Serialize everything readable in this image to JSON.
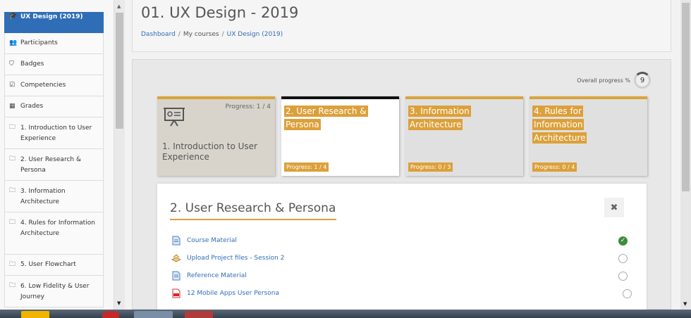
{
  "sidebar": {
    "items": [
      {
        "label": "UX Design (2019)",
        "icon": "graduation-cap-icon",
        "glyph": "🎓"
      },
      {
        "label": "Participants",
        "icon": "users-icon",
        "glyph": "👥"
      },
      {
        "label": "Badges",
        "icon": "shield-icon",
        "glyph": "⛉"
      },
      {
        "label": "Competencies",
        "icon": "checkbox-icon",
        "glyph": "☑"
      },
      {
        "label": "Grades",
        "icon": "table-icon",
        "glyph": "▦"
      },
      {
        "label": "1. Introduction to User Experience",
        "icon": "folder-icon",
        "glyph": "🗀"
      },
      {
        "label": "2. User Research & Persona",
        "icon": "folder-icon",
        "glyph": "🗀"
      },
      {
        "label": "3. Information Architecture",
        "icon": "folder-icon",
        "glyph": "🗀"
      },
      {
        "label": "4. Rules for Information Architecture",
        "icon": "folder-icon",
        "glyph": "🗀"
      },
      {
        "label": "5. User Flowchart",
        "icon": "folder-icon",
        "glyph": "🗀"
      },
      {
        "label": "6. Low Fidelity & User Journey",
        "icon": "folder-icon",
        "glyph": "🗀"
      }
    ]
  },
  "header": {
    "title": "01. UX Design - 2019",
    "breadcrumb": [
      "Dashboard",
      "My courses",
      "UX Design (2019)"
    ],
    "breadcrumb_sep": "/"
  },
  "overall": {
    "label": "Overall progress %",
    "value": "9"
  },
  "tiles": [
    {
      "title": "1. Introduction to User Experience",
      "progress": "Progress: 1 / 4"
    },
    {
      "title": "2. User Research & Persona",
      "progress": "Progress: 1 / 4"
    },
    {
      "title": "3. Information Architecture",
      "progress": "Progress: 0 / 3"
    },
    {
      "title": "4. Rules for Information Architecture",
      "progress": "Progress: 0 / 4"
    }
  ],
  "section": {
    "title": "2. User Research & Persona",
    "close_glyph": "✖",
    "activities": [
      {
        "label": "Course Material",
        "icon": "page-icon",
        "done": true
      },
      {
        "label": "Upload Project files - Session 2",
        "icon": "assignment-icon",
        "done": false
      },
      {
        "label": "Reference Material",
        "icon": "page-icon",
        "done": false
      },
      {
        "label": "12 Mobile Apps User Persona",
        "icon": "pdf-icon",
        "done": false
      }
    ]
  },
  "colors": {
    "accent": "#dca03a",
    "brand": "#2f6eb6",
    "done": "#3c8d3c"
  }
}
